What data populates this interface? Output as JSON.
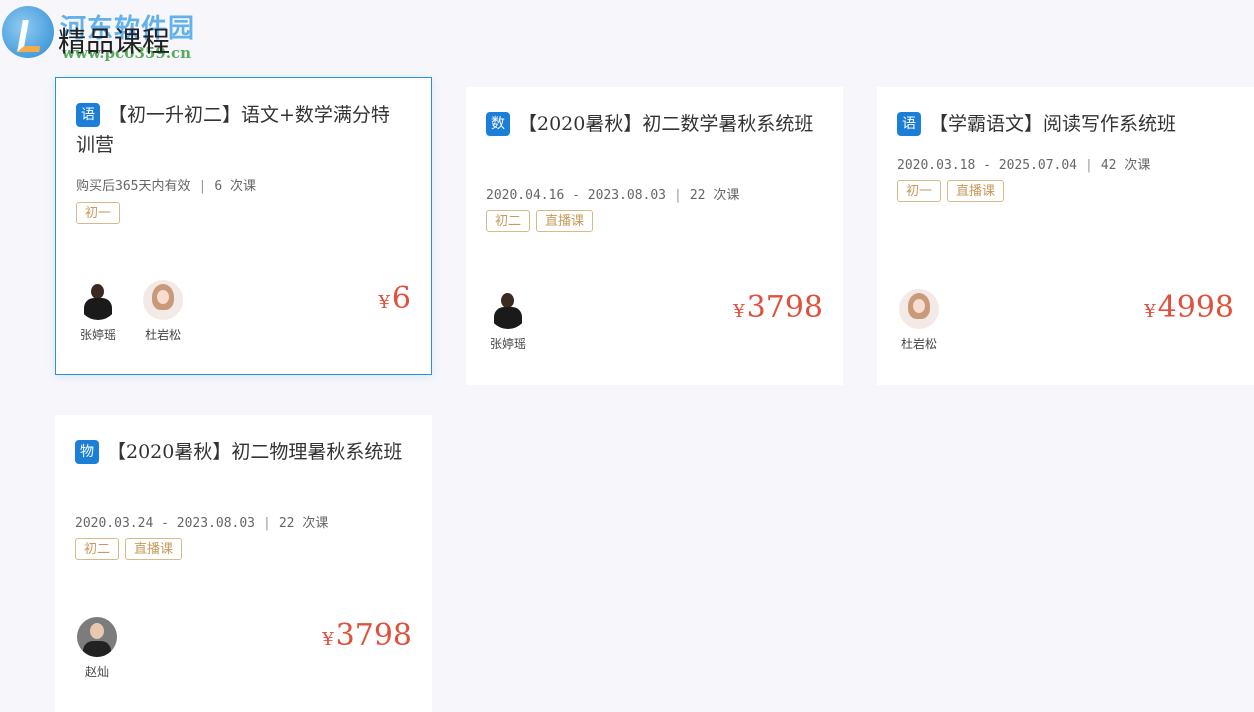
{
  "watermark": {
    "brand": "河东软件园",
    "url": "www.pc0359.cn"
  },
  "section": {
    "title": "精品课程"
  },
  "courses": [
    {
      "subject": "语",
      "title": "【初一升初二】语文+数学满分特训营",
      "meta_text": "购买后365天内有效",
      "lessons": "6 次课",
      "tags": [
        "初一"
      ],
      "teachers": [
        {
          "name": "张婷瑶",
          "avatar": "female-teacher-1"
        },
        {
          "name": "杜岩松",
          "avatar": "female-teacher-2"
        }
      ],
      "currency": "¥",
      "price": "6"
    },
    {
      "subject": "数",
      "title": "【2020暑秋】初二数学暑秋系统班",
      "meta_text": "2020.04.16 - 2023.08.03",
      "lessons": "22 次课",
      "tags": [
        "初二",
        "直播课"
      ],
      "teachers": [
        {
          "name": "张婷瑶",
          "avatar": "female-teacher-1"
        }
      ],
      "currency": "¥",
      "price": "3798"
    },
    {
      "subject": "语",
      "title": "【学霸语文】阅读写作系统班",
      "meta_text": "2020.03.18 - 2025.07.04",
      "lessons": "42 次课",
      "tags": [
        "初一",
        "直播课"
      ],
      "teachers": [
        {
          "name": "杜岩松",
          "avatar": "female-teacher-2"
        }
      ],
      "currency": "¥",
      "price": "4998"
    },
    {
      "subject": "物",
      "title": "【2020暑秋】初二物理暑秋系统班",
      "meta_text": "2020.03.24 - 2023.08.03",
      "lessons": "22 次课",
      "tags": [
        "初二",
        "直播课"
      ],
      "teachers": [
        {
          "name": "赵灿",
          "avatar": "male-teacher-1"
        }
      ],
      "currency": "¥",
      "price": "3798"
    }
  ]
}
